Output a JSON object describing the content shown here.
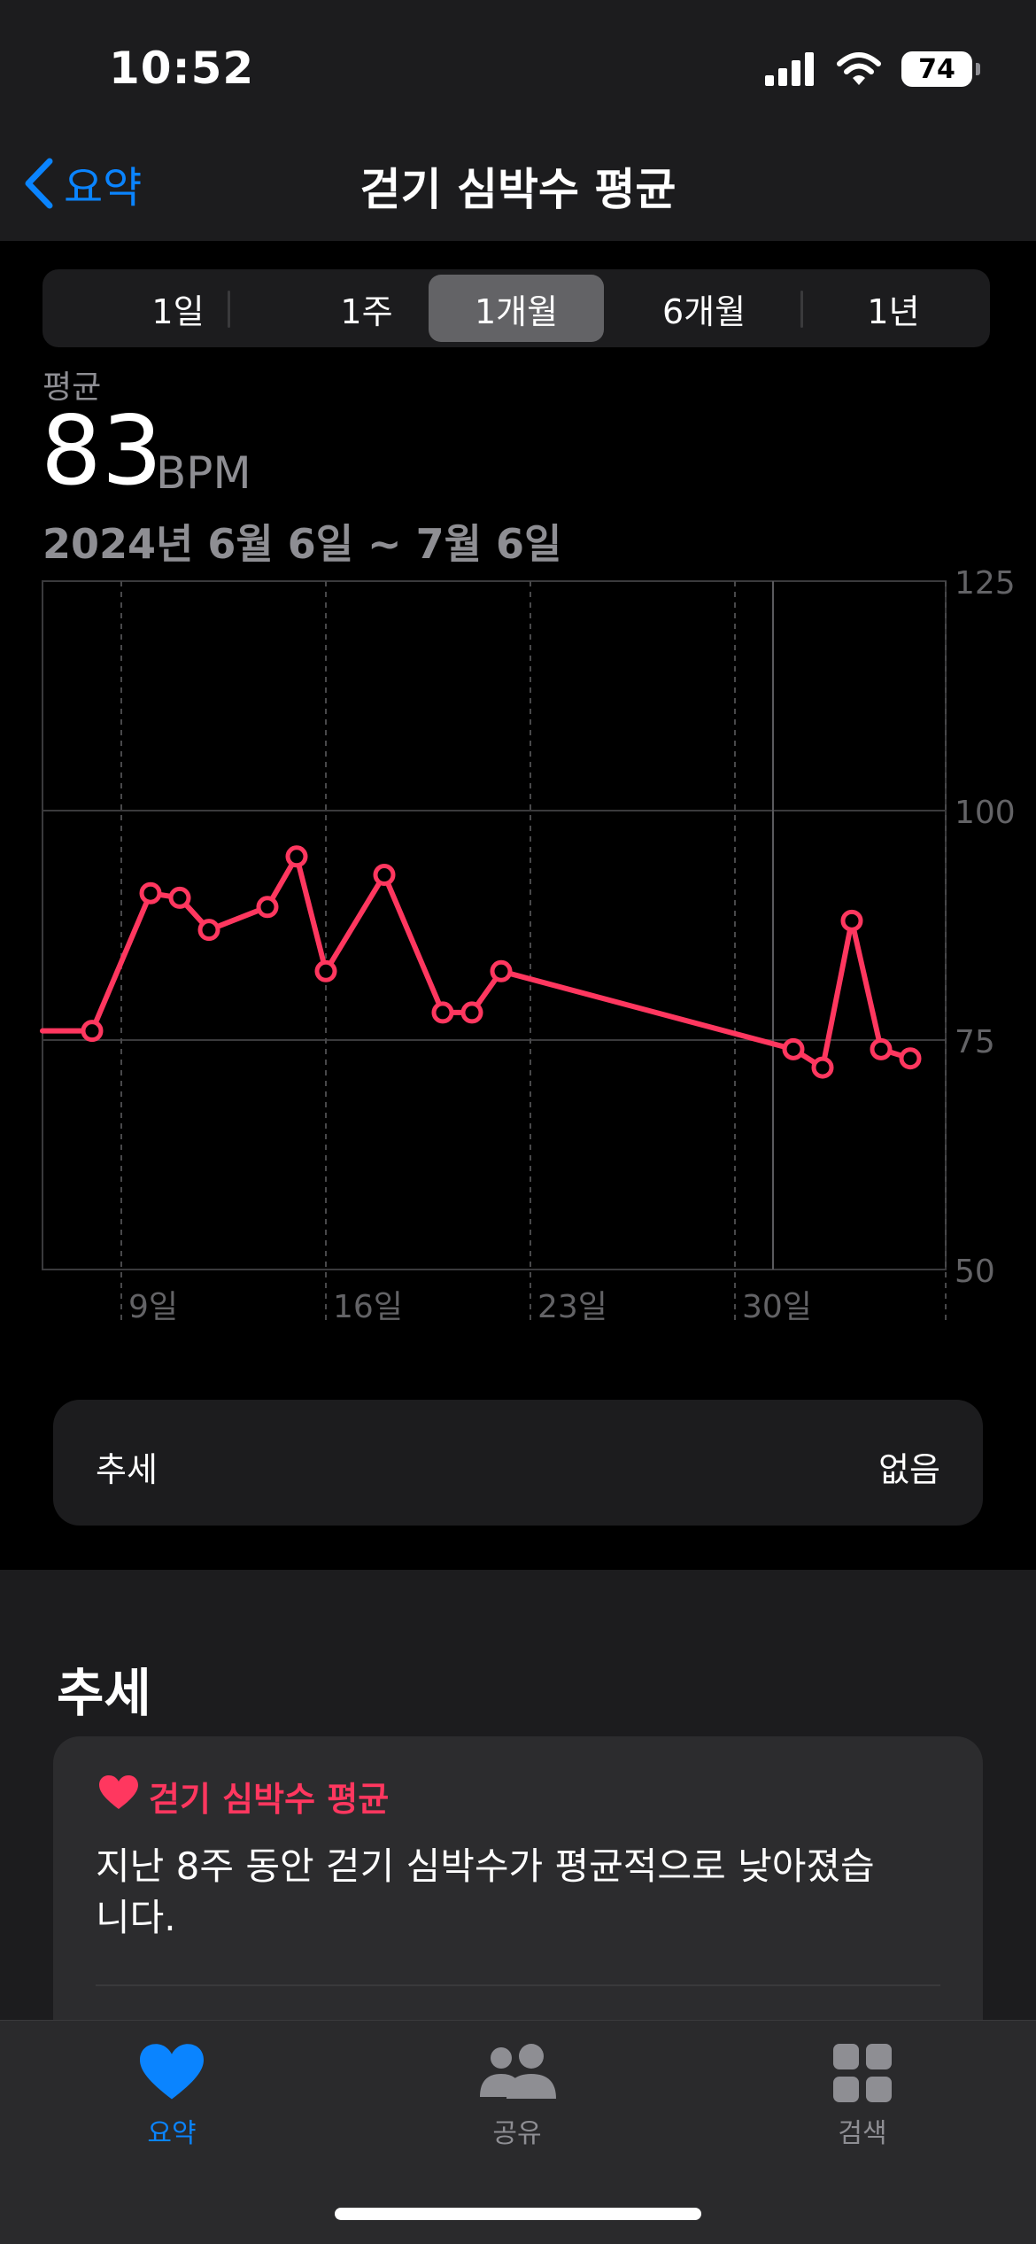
{
  "status_bar": {
    "time": "10:52",
    "battery": "74"
  },
  "nav": {
    "back_label": "요약",
    "title": "걷기 심박수 평균"
  },
  "segments": [
    {
      "label": "1일",
      "active": false
    },
    {
      "label": "1주",
      "active": false
    },
    {
      "label": "1개월",
      "active": true
    },
    {
      "label": "6개월",
      "active": false
    },
    {
      "label": "1년",
      "active": false
    }
  ],
  "summary": {
    "label": "평균",
    "value": "83",
    "unit": "BPM",
    "date_range": "2024년 6월 6일 ~ 7월 6일"
  },
  "chart_data": {
    "type": "line",
    "x_unit": "day",
    "tick_labels": [
      "9일",
      "16일",
      "23일",
      "30일"
    ],
    "y_tick_labels": [
      "125",
      "100",
      "75",
      "50"
    ],
    "ylim": [
      50,
      125
    ],
    "x_range": [
      "2024-06-06",
      "2024-07-06"
    ],
    "series": [
      {
        "color": "#ff375f",
        "points": [
          {
            "x": "2024-06-08",
            "y": 76
          },
          {
            "x": "2024-06-10",
            "y": 91
          },
          {
            "x": "2024-06-11",
            "y": 90.5
          },
          {
            "x": "2024-06-12",
            "y": 87
          },
          {
            "x": "2024-06-14",
            "y": 89.5
          },
          {
            "x": "2024-06-15",
            "y": 95
          },
          {
            "x": "2024-06-16",
            "y": 82.5
          },
          {
            "x": "2024-06-18",
            "y": 93
          },
          {
            "x": "2024-06-20",
            "y": 78
          },
          {
            "x": "2024-06-21",
            "y": 78
          },
          {
            "x": "2024-06-22",
            "y": 82.5
          },
          {
            "x": "2024-07-02",
            "y": 74
          },
          {
            "x": "2024-07-03",
            "y": 72
          },
          {
            "x": "2024-07-04",
            "y": 88
          },
          {
            "x": "2024-07-05",
            "y": 74
          },
          {
            "x": "2024-07-06",
            "y": 73
          }
        ]
      }
    ],
    "grid": true
  },
  "trend_row": {
    "label": "추세",
    "value": "없음"
  },
  "trends_section": {
    "title": "추세",
    "card_title": "걷기 심박수 평균",
    "card_text": "지난 8주 동안 걷기 심박수가 평균적으로 낮아졌습니다."
  },
  "tabbar": [
    {
      "label": "요약",
      "icon": "heart-icon",
      "active": true
    },
    {
      "label": "공유",
      "icon": "people-icon",
      "active": false
    },
    {
      "label": "검색",
      "icon": "grid-icon",
      "active": false
    }
  ],
  "colors": {
    "accent": "#0a84ff",
    "chart_line": "#ff375f",
    "background": "#000000",
    "panel": "#1c1c1e"
  }
}
